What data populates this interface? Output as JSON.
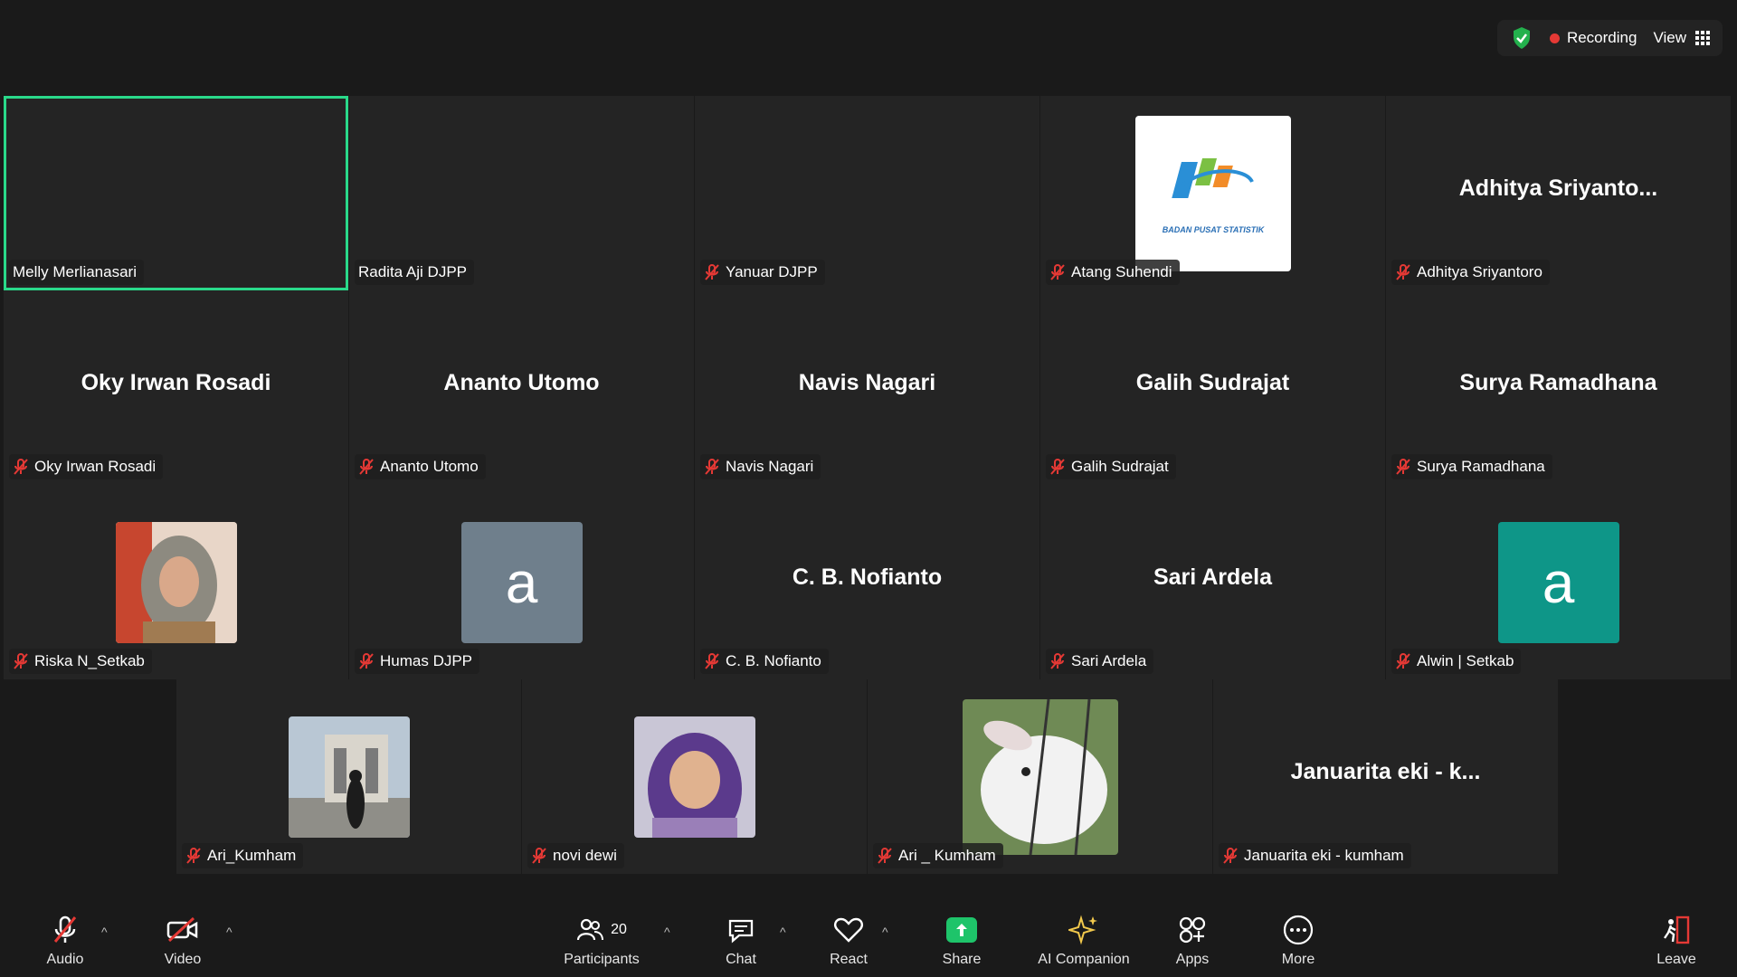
{
  "top": {
    "recording_label": "Recording",
    "view_label": "View"
  },
  "tiles": [
    {
      "label": "Melly Merlianasari"
    },
    {
      "label": "Radita Aji DJPP"
    },
    {
      "label": "Yanuar DJPP"
    },
    {
      "label": "Atang Suhendi",
      "logo_text": "BADAN PUSAT STATISTIK"
    },
    {
      "label": "Adhitya Sriyantoro",
      "big": "Adhitya  Sriyanto..."
    },
    {
      "label": "Oky Irwan Rosadi",
      "big": "Oky Irwan Rosadi"
    },
    {
      "label": "Ananto Utomo",
      "big": "Ananto Utomo"
    },
    {
      "label": "Navis Nagari",
      "big": "Navis Nagari"
    },
    {
      "label": "Galih Sudrajat",
      "big": "Galih Sudrajat"
    },
    {
      "label": "Surya Ramadhana",
      "big": "Surya Ramadhana"
    },
    {
      "label": "Riska N_Setkab"
    },
    {
      "label": "Humas DJPP",
      "letter": "a"
    },
    {
      "label": "C. B. Nofianto",
      "big": "C. B. Nofianto"
    },
    {
      "label": "Sari Ardela",
      "big": "Sari Ardela"
    },
    {
      "label": "Alwin | Setkab",
      "letter": "a"
    },
    {
      "label": "Ari_Kumham"
    },
    {
      "label": "novi dewi"
    },
    {
      "label": "Ari _ Kumham"
    },
    {
      "label": "Januarita eki - kumham",
      "big": "Januarita eki - k..."
    }
  ],
  "toolbar": {
    "audio": "Audio",
    "video": "Video",
    "participants": "Participants",
    "participants_count": "20",
    "chat": "Chat",
    "react": "React",
    "share": "Share",
    "ai_companion": "AI Companion",
    "apps": "Apps",
    "more": "More",
    "leave": "Leave"
  },
  "colors": {
    "background": "#1a1a1a",
    "tile": "#242424",
    "active_border": "#2ad98a",
    "muted_mic": "#e53935",
    "share": "#1ec46a",
    "avatar_gray": "#6f7f8c",
    "avatar_teal": "#0e9688"
  }
}
